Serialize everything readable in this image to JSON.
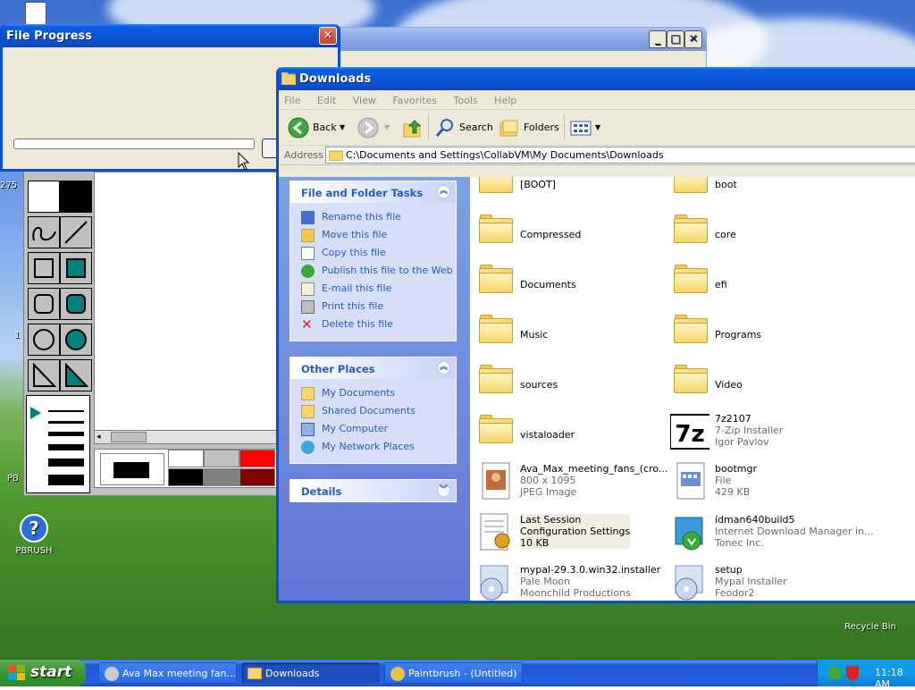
{
  "desktop": {
    "icons": [
      {
        "label": "PBRUSH"
      },
      {
        "label": "Recycle Bin"
      }
    ],
    "partial_labels": {
      "left_1": "275",
      "left_2": "PB",
      "left_3": "1"
    }
  },
  "file_progress": {
    "title": "File Progress"
  },
  "explorer": {
    "title": "Downloads",
    "menu": [
      "File",
      "Edit",
      "View",
      "Favorites",
      "Tools",
      "Help"
    ],
    "toolbar": {
      "back": "Back",
      "search": "Search",
      "folders": "Folders"
    },
    "address_label": "Address",
    "address": "C:\\Documents and Settings\\CollabVM\\My Documents\\Downloads",
    "tasks": {
      "title": "File and Folder Tasks",
      "items": [
        "Rename this file",
        "Move this file",
        "Copy this file",
        "Publish this file to the Web",
        "E-mail this file",
        "Print this file",
        "Delete this file"
      ]
    },
    "places": {
      "title": "Other Places",
      "items": [
        "My Documents",
        "Shared Documents",
        "My Computer",
        "My Network Places"
      ]
    },
    "details": {
      "title": "Details"
    },
    "files": [
      {
        "name": "[BOOT]",
        "kind": "folder"
      },
      {
        "name": "boot",
        "kind": "folder"
      },
      {
        "name": "Compressed",
        "kind": "folder"
      },
      {
        "name": "core",
        "kind": "folder"
      },
      {
        "name": "Documents",
        "kind": "folder"
      },
      {
        "name": "efi",
        "kind": "folder"
      },
      {
        "name": "Music",
        "kind": "folder"
      },
      {
        "name": "Programs",
        "kind": "folder"
      },
      {
        "name": "sources",
        "kind": "folder"
      },
      {
        "name": "Video",
        "kind": "folder"
      },
      {
        "name": "vistaloader",
        "kind": "folder"
      },
      {
        "name": "7z2107",
        "line2": "7-Zip Installer",
        "line3": "Igor Pavlov",
        "kind": "7z"
      },
      {
        "name": "Ava_Max_meeting_fans_(cro...",
        "line2": "800 x 1095",
        "line3": "JPEG Image",
        "kind": "jpeg"
      },
      {
        "name": "bootmgr",
        "line2": "File",
        "line3": "429 KB",
        "kind": "file"
      },
      {
        "name": "Last Session",
        "line2": "Configuration Settings",
        "line3": "10 KB",
        "kind": "config"
      },
      {
        "name": "idman640build5",
        "line2": "Internet Download Manager in...",
        "line3": "Tonec Inc.",
        "kind": "idm"
      },
      {
        "name": "mypal-29.3.0.win32.installer",
        "line2": "Pale Moon",
        "line3": "Moonchild Productions",
        "kind": "installer"
      },
      {
        "name": "setup",
        "line2": "Mypal Installer",
        "line3": "Feodor2",
        "kind": "installer"
      }
    ]
  },
  "taskbar": {
    "start": "start",
    "tasks": [
      "Ava Max meeting fan...",
      "Downloads",
      "Paintbrush - (Untitled)"
    ],
    "clock": "11:18 AM"
  },
  "colors": {
    "xp_blue": "#0a54d9",
    "link_blue": "#215dc6",
    "taskbar": "#2663e0"
  }
}
